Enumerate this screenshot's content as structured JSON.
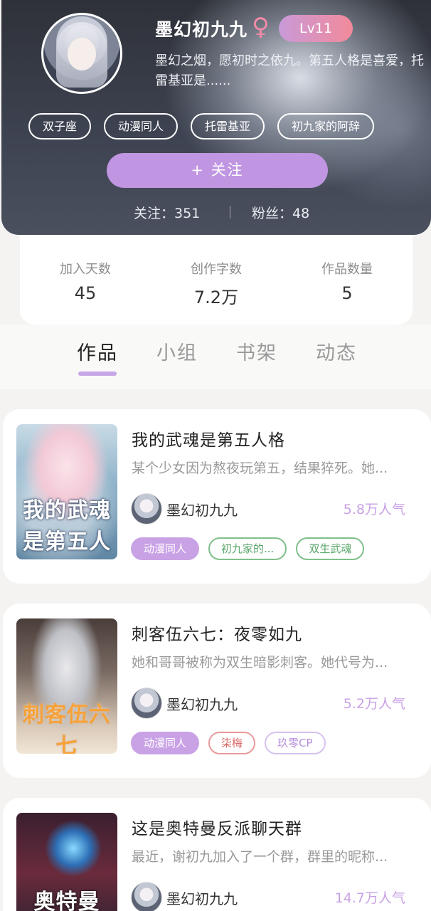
{
  "profile": {
    "username": "墨幻初九九",
    "gender_symbol": "♀",
    "level": "Lv11",
    "bio": "墨幻之烟，愿初时之依九。第五人格是喜爱，托雷基亚是......",
    "tags": [
      "双子座",
      "动漫同人",
      "托雷基亚",
      "初九家的阿辞"
    ],
    "follow_button": "+ 关注",
    "following_label": "关注：351",
    "fans_label": "粉丝：48"
  },
  "stats": {
    "days_label": "加入天数",
    "days_value": "45",
    "words_label": "创作字数",
    "words_value": "7.2万",
    "works_label": "作品数量",
    "works_value": "5"
  },
  "tabs": [
    {
      "label": "作品",
      "active": true
    },
    {
      "label": "小组",
      "active": false
    },
    {
      "label": "书架",
      "active": false
    },
    {
      "label": "动态",
      "active": false
    }
  ],
  "works": [
    {
      "title": "我的武魂是第五人格",
      "description": "某个少女因为熬夜玩第五，结果猝死。她...",
      "cover_text": "我的武魂是第五人格",
      "author": "墨幻初九九",
      "popularity": "5.8万人气",
      "tags": [
        {
          "label": "动漫同人",
          "style": "purple"
        },
        {
          "label": "初九家的...",
          "style": "green"
        },
        {
          "label": "双生武魂",
          "style": "green"
        }
      ]
    },
    {
      "title": "刺客伍六七：夜零如九",
      "description": "她和哥哥被称为双生暗影刺客。她代号为...",
      "cover_text": "刺客伍六七",
      "author": "墨幻初九九",
      "popularity": "5.2万人气",
      "tags": [
        {
          "label": "动漫同人",
          "style": "purple"
        },
        {
          "label": "柒梅",
          "style": "red"
        },
        {
          "label": "玖零CP",
          "style": "lav"
        }
      ]
    },
    {
      "title": "这是奥特曼反派聊天群",
      "description": "最近，谢初九加入了一个群，群里的昵称...",
      "cover_text": "奥特曼",
      "author": "墨幻初九九",
      "popularity": "14.7万人气",
      "tags": []
    }
  ]
}
